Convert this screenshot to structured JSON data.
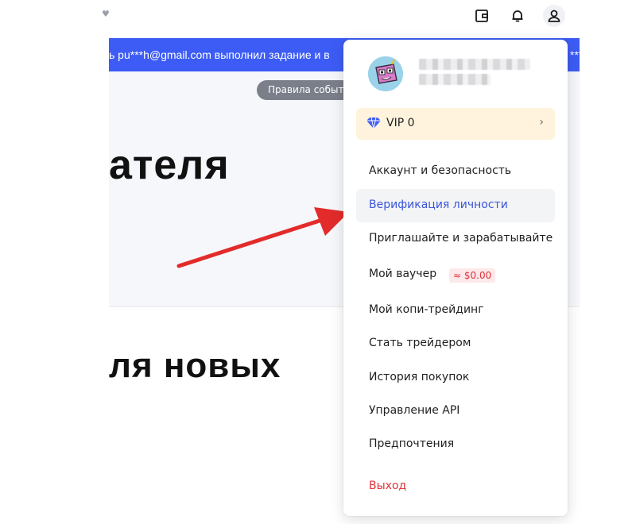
{
  "topbar": {
    "fragment": "♥",
    "icons": [
      "wallet-icon",
      "bell-icon",
      "user-icon"
    ]
  },
  "banner": {
    "text": "ь pu***h@gmail.com выполнил задание и в",
    "tail": "***"
  },
  "hero": {
    "rules_button": "Правила событи",
    "title": "ателя"
  },
  "section": {
    "title": "ля новых"
  },
  "dropdown": {
    "vip_label": "VIP 0",
    "vip_chevron": "›",
    "items": [
      {
        "label": "Аккаунт и безопасность"
      },
      {
        "label": "Верификация личности"
      },
      {
        "label": "Приглашайте и зарабатывайте"
      },
      {
        "label": "Мой ваучер",
        "badge": "≈ $0.00"
      },
      {
        "label": "Мой копи-трейдинг"
      },
      {
        "label": "Стать трейдером"
      },
      {
        "label": "История покупок"
      },
      {
        "label": "Управление API"
      },
      {
        "label": "Предпочтения"
      },
      {
        "label": "Выход"
      }
    ]
  },
  "colors": {
    "banner": "#3d5cf5",
    "active_text": "#3b55d9",
    "logout_text": "#e1323a",
    "vip_bg": "#fff3dd",
    "annotation_arrow": "#e32b2b"
  }
}
